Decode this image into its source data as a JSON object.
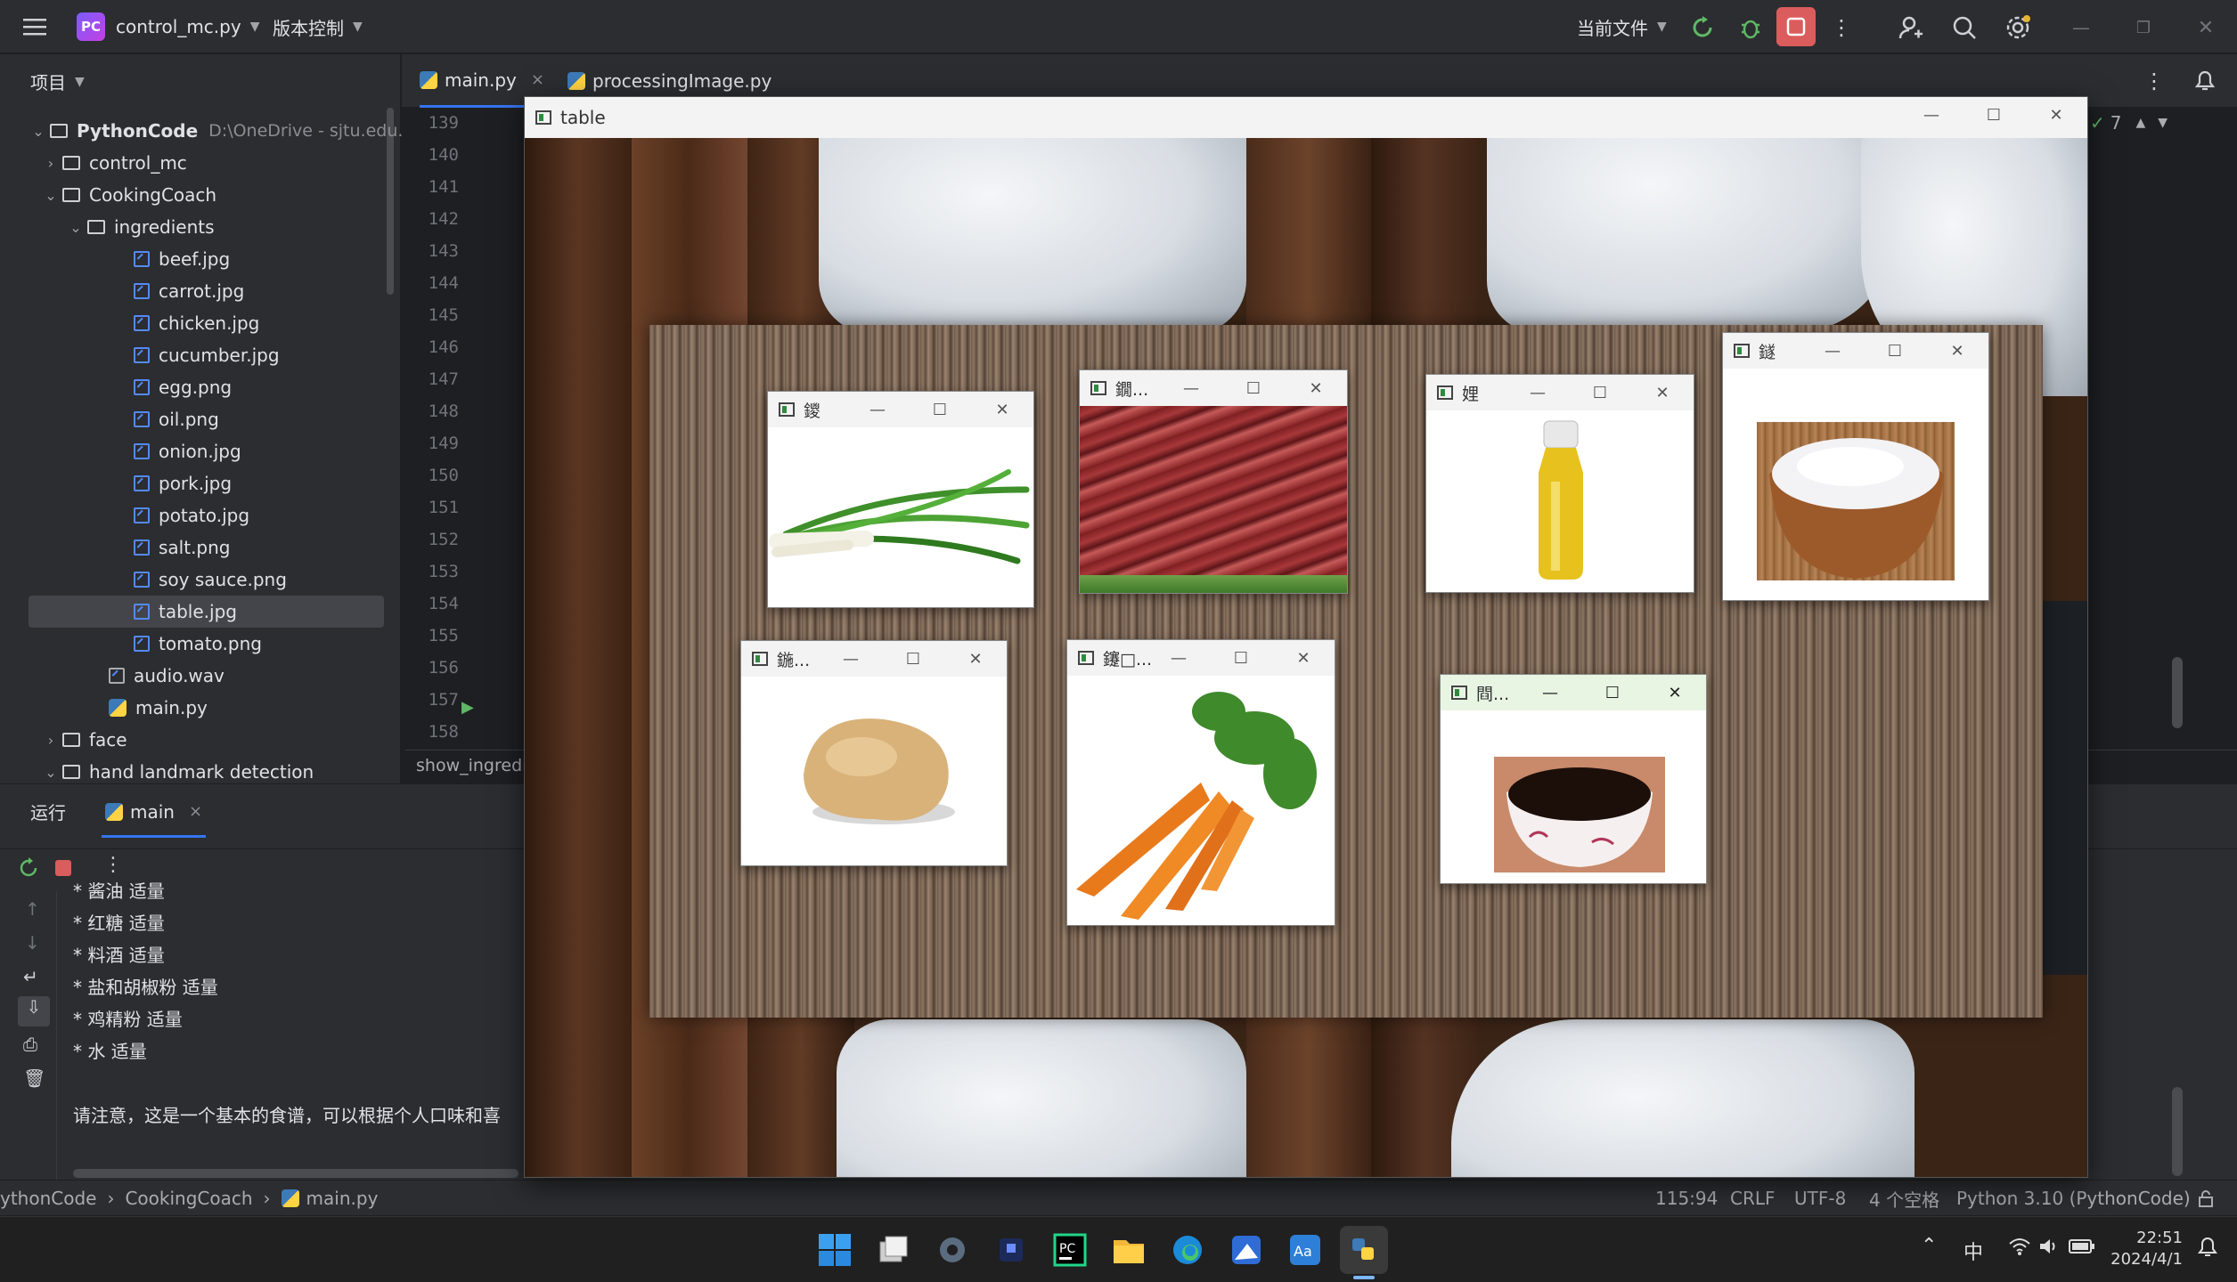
{
  "titlebar": {
    "project_badge": "PC",
    "project_name": "control_mc.py",
    "vcs_label": "版本控制",
    "run_config": "当前文件"
  },
  "project_panel": {
    "header": "项目",
    "root_name": "PythonCode",
    "root_path": "D:\\OneDrive - sjtu.edu.cn",
    "items": [
      {
        "label": "control_mc",
        "kind": "folder",
        "expanded": false
      },
      {
        "label": "CookingCoach",
        "kind": "folder",
        "expanded": true
      },
      {
        "label": "ingredients",
        "kind": "folder",
        "expanded": true
      },
      {
        "label": "beef.jpg",
        "kind": "image"
      },
      {
        "label": "carrot.jpg",
        "kind": "image"
      },
      {
        "label": "chicken.jpg",
        "kind": "image"
      },
      {
        "label": "cucumber.jpg",
        "kind": "image"
      },
      {
        "label": "egg.png",
        "kind": "image"
      },
      {
        "label": "oil.png",
        "kind": "image"
      },
      {
        "label": "onion.jpg",
        "kind": "image"
      },
      {
        "label": "pork.jpg",
        "kind": "image"
      },
      {
        "label": "potato.jpg",
        "kind": "image"
      },
      {
        "label": "salt.png",
        "kind": "image"
      },
      {
        "label": "soy sauce.png",
        "kind": "image"
      },
      {
        "label": "table.jpg",
        "kind": "image",
        "selected": true
      },
      {
        "label": "tomato.png",
        "kind": "image"
      },
      {
        "label": "audio.wav",
        "kind": "audio"
      },
      {
        "label": "main.py",
        "kind": "python"
      },
      {
        "label": "face",
        "kind": "folder",
        "expanded": false
      },
      {
        "label": "hand landmark detection",
        "kind": "folder",
        "expanded": true
      }
    ]
  },
  "editor": {
    "tabs": [
      {
        "label": "main.py",
        "active": true
      },
      {
        "label": "processingImage.py",
        "active": false
      }
    ],
    "line_numbers": [
      "139",
      "140",
      "141",
      "142",
      "143",
      "144",
      "145",
      "146",
      "147",
      "148",
      "149",
      "150",
      "151",
      "152",
      "153",
      "154",
      "155",
      "156",
      "157",
      "158"
    ],
    "breadcrumb_fn": "show_ingredi",
    "inspection_count": "7"
  },
  "run_panel": {
    "tab_label": "运行",
    "config_tab": "main",
    "console_lines": [
      "* 酱油 适量",
      "* 红糖 适量",
      "* 料酒 适量",
      "* 盐和胡椒粉 适量",
      "* 鸡精粉 适量",
      "* 水 适量",
      "",
      "请注意，这是一个基本的食谱，可以根据个人口味和喜"
    ]
  },
  "status_bar": {
    "path": [
      "ythonCode",
      "CookingCoach",
      "main.py"
    ],
    "position": "115:94",
    "line_sep": "CRLF",
    "encoding": "UTF-8",
    "indent": "4 个空格",
    "interpreter": "Python 3.10 (PythonCode)"
  },
  "table_window": {
    "title": "table",
    "subwindows": [
      {
        "title": "鑁",
        "ingredient": "onion"
      },
      {
        "title": "鐗...",
        "ingredient": "beef"
      },
      {
        "title": "娌",
        "ingredient": "oil"
      },
      {
        "title": "鐩",
        "ingredient": "salt"
      },
      {
        "title": "鍦...",
        "ingredient": "potato"
      },
      {
        "title": "鑳□...",
        "ingredient": "carrot"
      },
      {
        "title": "閰...",
        "ingredient": "soy sauce"
      }
    ]
  },
  "taskbar": {
    "ime": "中",
    "time": "22:51",
    "date": "2024/4/1"
  },
  "colors": {
    "ide_bg": "#1e1f22",
    "panel_bg": "#2b2d30",
    "accent_green": "#5fb865",
    "stop_red": "#db5c5c",
    "selection": "#43454a"
  }
}
